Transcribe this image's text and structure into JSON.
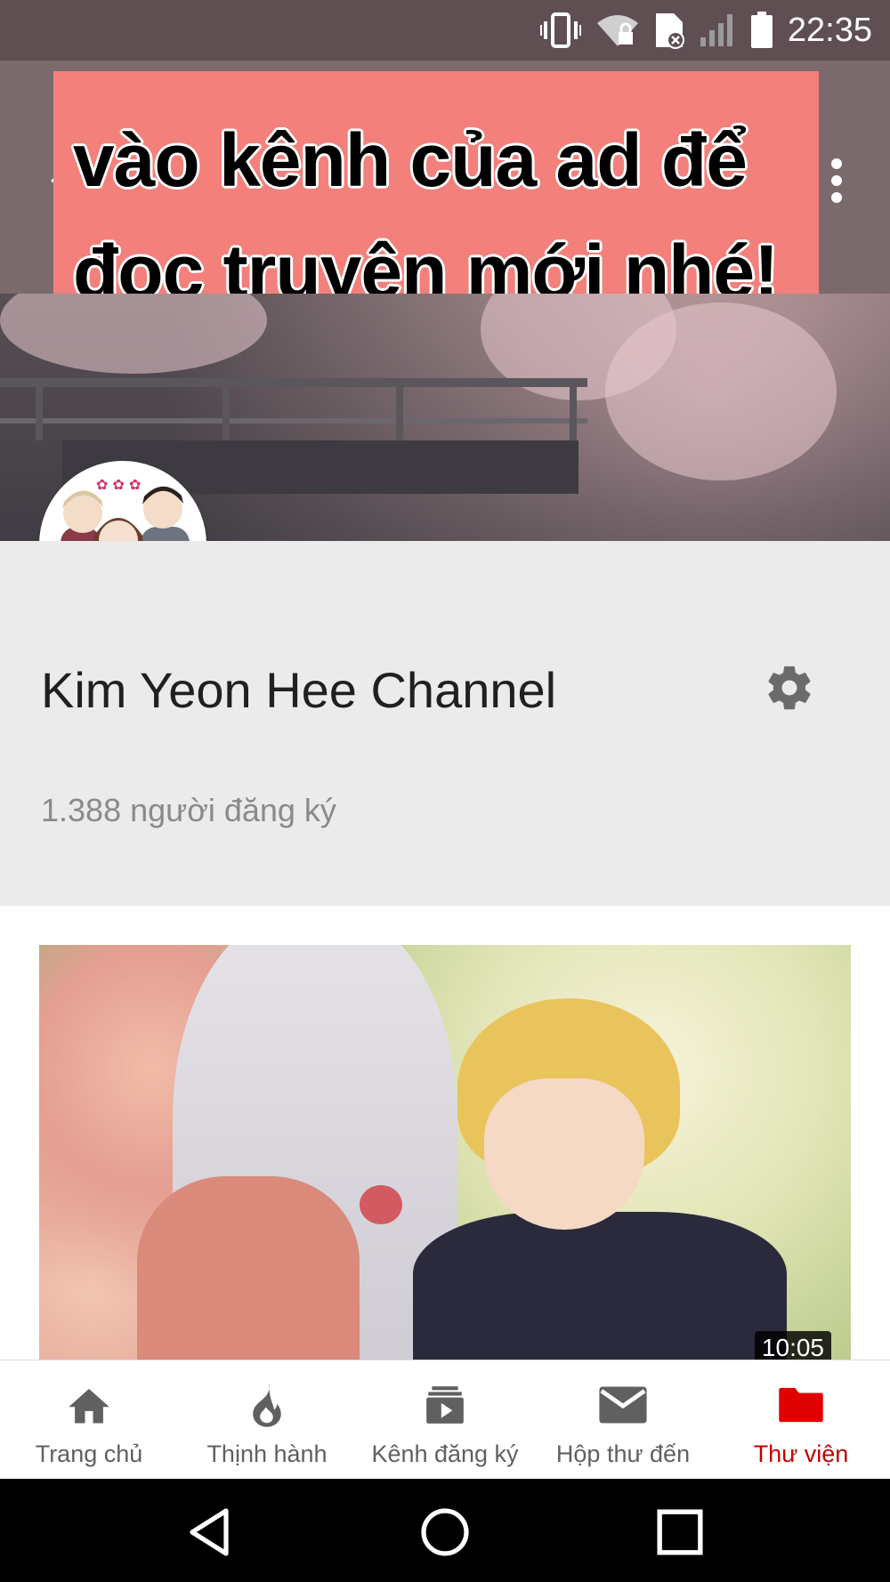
{
  "status_bar": {
    "time": "22:35",
    "icons": [
      "vibrate-icon",
      "wifi-lock-icon",
      "sim-error-icon",
      "signal-icon",
      "battery-icon"
    ]
  },
  "caption": {
    "line1": "vào kênh của ad để",
    "line2": "đọc truyện mới nhé!",
    "background": "#f3807b"
  },
  "channel": {
    "name": "Kim Yeon Hee Channel",
    "subscribers": "1.388 người đăng ký"
  },
  "video": {
    "duration": "10:05"
  },
  "bottom_nav": {
    "items": [
      {
        "label": "Trang chủ",
        "icon": "home-icon"
      },
      {
        "label": "Thịnh hành",
        "icon": "trending-fire-icon"
      },
      {
        "label": "Kênh đăng ký",
        "icon": "subscriptions-icon"
      },
      {
        "label": "Hộp thư đến",
        "icon": "inbox-icon"
      },
      {
        "label": "Thư viện",
        "icon": "library-folder-icon"
      }
    ],
    "active_index": 4,
    "active_color": "#c40000"
  },
  "system_nav": {
    "icons": [
      "back-triangle-icon",
      "home-circle-icon",
      "recents-square-icon"
    ]
  }
}
